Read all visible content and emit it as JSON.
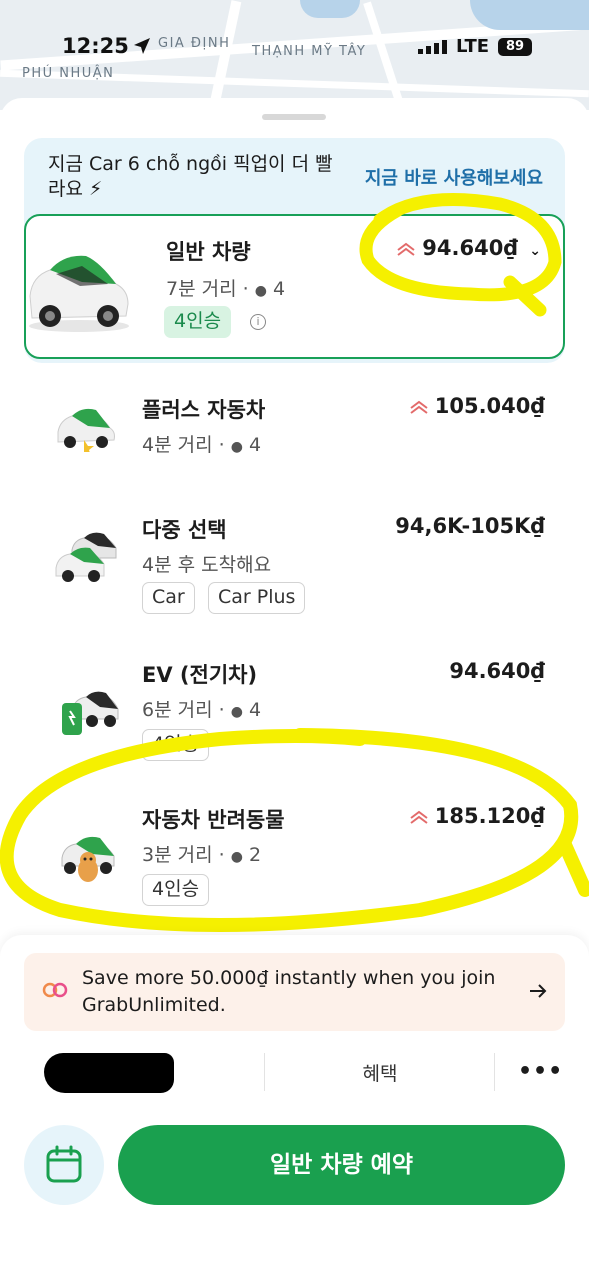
{
  "status_bar": {
    "time": "12:25",
    "network": "LTE",
    "battery": "89"
  },
  "map": {
    "labels": [
      "GIA ĐỊNH",
      "THẠNH MỸ TÂY",
      "PHÚ NHUẬN"
    ]
  },
  "promo_banner": {
    "text": "지금 Car 6 chỗ ngồi 픽업이 더 빨라요 ⚡",
    "cta": "지금 바로 사용해보세요"
  },
  "rides": [
    {
      "name": "일반 차량",
      "sub": "7분 거리 · ",
      "seats": "4",
      "price": "94.640₫",
      "surge": true,
      "chips": [
        "4인승"
      ],
      "selected": true
    },
    {
      "name": "플러스 자동차",
      "sub": "4분 거리 · ",
      "seats": "4",
      "price": "105.040₫",
      "surge": true,
      "chips": []
    },
    {
      "name": "다중 선택",
      "sub": "4분 후 도착해요",
      "price": "94,6K-105K₫",
      "surge": false,
      "chips": [
        "Car",
        "Car Plus"
      ]
    },
    {
      "name": "EV (전기차)",
      "sub": "6분 거리 · ",
      "seats": "4",
      "price": "94.640₫",
      "surge": false,
      "chips": [
        "4인승"
      ]
    },
    {
      "name": "자동차 반려동물",
      "sub": "3분 거리 · ",
      "seats": "2",
      "price": "185.120₫",
      "surge": true,
      "chips": [
        "4인승"
      ]
    }
  ],
  "unlimited_banner": {
    "text": "Save more 50.000₫ instantly when you join GrabUnlimited."
  },
  "options": {
    "benefit_label": "혜택",
    "more_label": "•••"
  },
  "book_button": {
    "label": "일반 차량 예약"
  },
  "colors": {
    "brand_green": "#1aa04f",
    "highlight_yellow": "#f5f000",
    "promo_bg": "#e6f4fa"
  }
}
